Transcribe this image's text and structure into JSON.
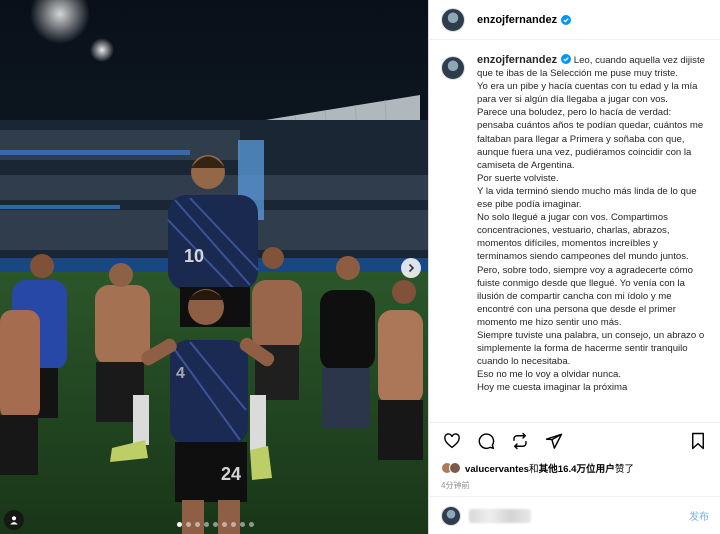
{
  "post": {
    "username": "enzojfernandez",
    "verified": true,
    "carousel": {
      "total": 9,
      "active": 0
    }
  },
  "photo": {
    "jersey_numbers": [
      "10",
      "24"
    ]
  },
  "caption": {
    "username": "enzojfernandez",
    "lines": [
      "Leo, cuando aquella vez dijiste que te ibas de la Selección me puse muy triste.",
      "Yo era un pibe y hacía cuentas con tu edad y la mía para ver si algún día llegaba a jugar con vos.",
      "Parece una boludez, pero lo hacía de verdad: pensaba cuántos años te podían quedar, cuántos me faltaban para llegar a Primera y soñaba con que, aunque fuera una vez, pudiéramos coincidir con la camiseta de Argentina.",
      "Por suerte volviste.",
      "Y la vida terminó siendo mucho más linda de lo que ese pibe podía imaginar.",
      "No solo llegué a jugar con vos. Compartimos concentraciones, vestuario, charlas, abrazos, momentos difíciles, momentos increíbles y terminamos siendo campeones del mundo juntos.",
      "Pero, sobre todo, siempre voy a agradecerte cómo fuiste conmigo desde que llegué. Yo venía con la ilusión de compartir cancha con mi ídolo y me encontré con una persona que desde el primer momento me hizo sentir uno más.",
      "Siempre tuviste una palabra, un consejo, un abrazo o simplemente la forma de hacerme sentir tranquilo cuando lo necesitaba.",
      "Eso no me lo voy a olvidar nunca.",
      "Hoy me cuesta imaginar la próxima"
    ]
  },
  "likes": {
    "user": "valucervantes",
    "text": "和 其他16.4万位用户 赞了",
    "and": "和",
    "others": "其他16.4万位用户",
    "suffix": "赞了"
  },
  "time_ago": "4分钟前",
  "composer": {
    "post_label": "发布"
  },
  "colors": {
    "verified": "#0095f6",
    "post_disabled": "#7fb3e6",
    "muted": "#8e8e8e"
  },
  "icons": [
    "heart-icon",
    "comment-icon",
    "repost-icon",
    "share-icon",
    "save-icon",
    "chevron-right-icon",
    "user-tag-icon",
    "verified-badge-icon"
  ]
}
